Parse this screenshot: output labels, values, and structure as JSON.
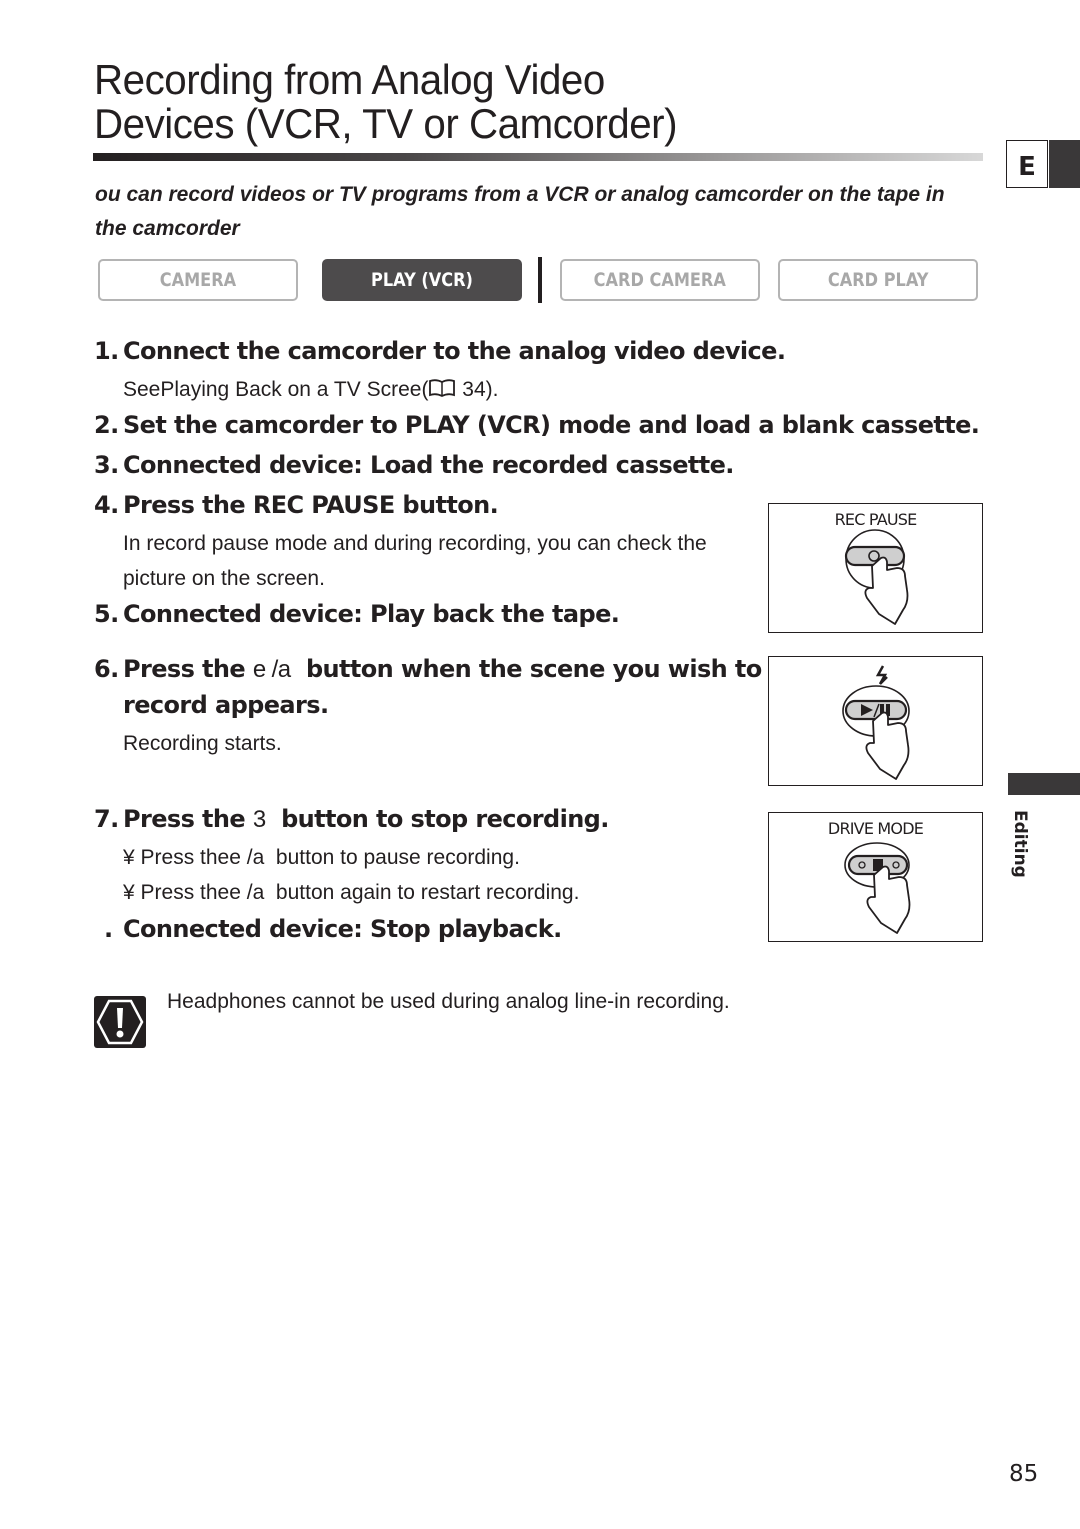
{
  "header": {
    "title_line1": "Recording from Analog Video",
    "title_line2": "Devices (VCR, TV or Camcorder)",
    "language_tab": "E"
  },
  "intro": {
    "line1": " ou can record videos or TV programs from a VCR or analog camcorder on the tape in",
    "line2": "the camcorder"
  },
  "modes": [
    {
      "label": "CAMERA",
      "active": false
    },
    {
      "label": "PLAY (VCR)",
      "active": true
    },
    {
      "label": "CARD CAMERA",
      "active": false
    },
    {
      "label": "CARD PLAY",
      "active": false
    }
  ],
  "steps": [
    {
      "num": "1.",
      "text": "Connect the camcorder to the analog video device.",
      "notes": [
        "SeePlaying Back on a TV Screen(&#x1F56E; 34)."
      ]
    },
    {
      "num": "2.",
      "text": "Set the camcorder to PLAY (VCR) mode and load a blank cassette."
    },
    {
      "num": "3.",
      "text": "Connected device: Load the recorded cassette."
    },
    {
      "num": "4.",
      "text": "Press the REC PAUSE button.",
      "notes": [
        "In record pause mode and during recording, you can check the",
        "picture on the screen."
      ]
    },
    {
      "num": "5.",
      "text": "Connected device: Play back the tape."
    },
    {
      "num": "6.",
      "text_line1_a": "Press the ",
      "text_line1_sym": "e /a",
      "text_line1_b": "  button when the scene you wish to",
      "text_line2": "record appears.",
      "notes": [
        "Recording starts."
      ]
    },
    {
      "num": "7.",
      "text_a": "Press the ",
      "text_sym": "3",
      "text_b": "  button to stop recording.",
      "notes": [
        "¥ Press thee /a  button to pause recording.",
        "¥ Press thee /a  button again to restart recording."
      ]
    },
    {
      "num": ".",
      "text": "Connected device: Stop playback."
    }
  ],
  "step1_note_a": "SeePlaying Back on a TV Scree",
  "step1_note_b": "( ",
  "step1_note_c": " 34).",
  "figures": [
    {
      "label": "REC PAUSE",
      "button": "rec-pause"
    },
    {
      "label": "",
      "button": "play-pause"
    },
    {
      "label": "DRIVE MODE",
      "button": "stop"
    }
  ],
  "side_label": "Editing",
  "caution": "Headphones cannot be used during analog line-in recording.",
  "page_number": "85"
}
